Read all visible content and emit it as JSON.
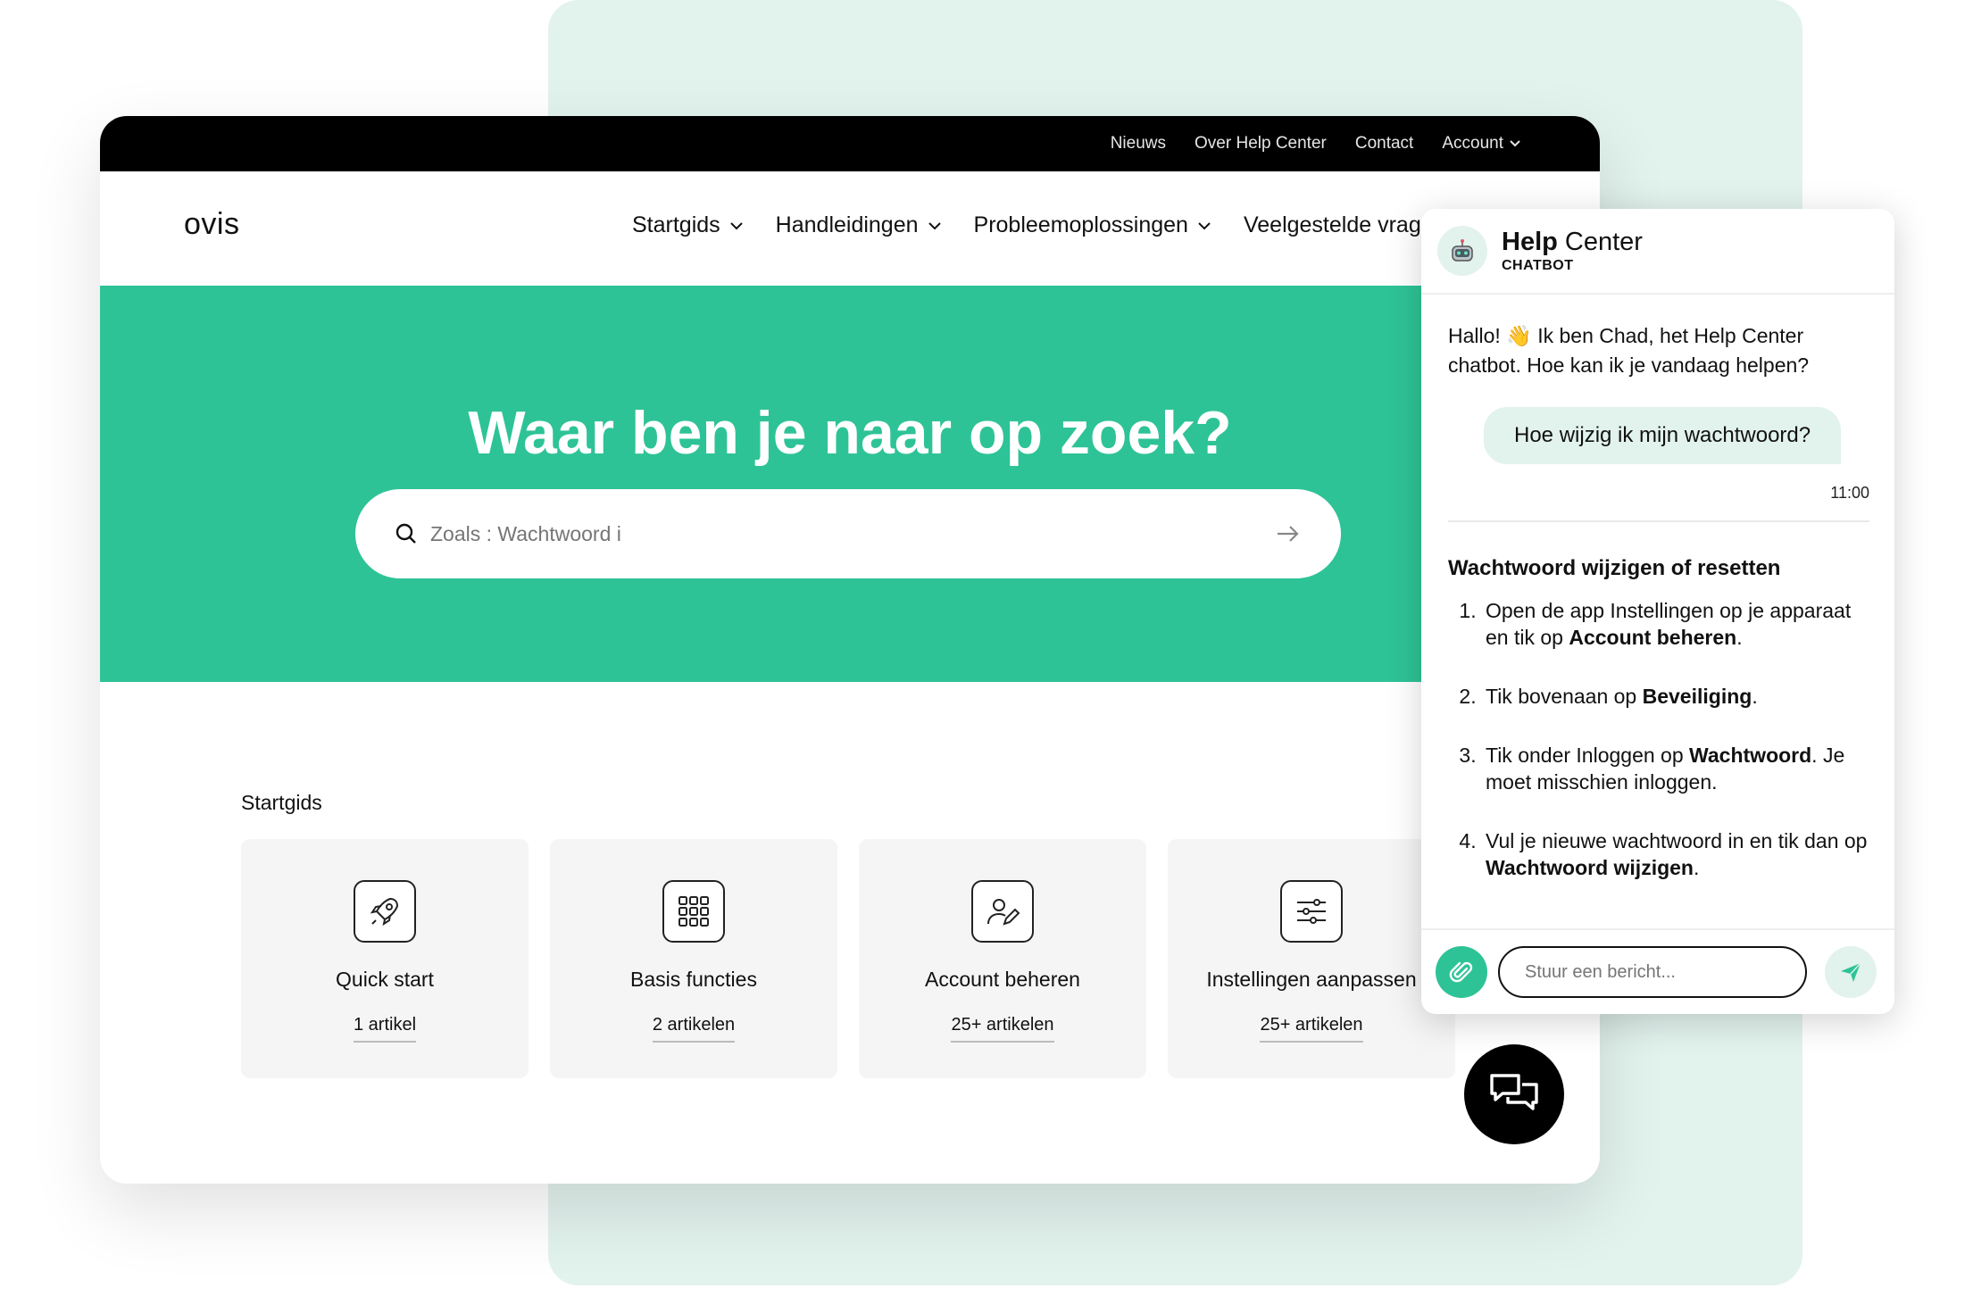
{
  "topbar": {
    "items": [
      "Nieuws",
      "Over Help Center",
      "Contact"
    ],
    "account": "Account"
  },
  "logo": "ovis",
  "menu": [
    "Startgids",
    "Handleidingen",
    "Probleemoplossingen",
    "Veelgestelde vrag"
  ],
  "hero": {
    "title": "Waar ben je naar op zoek?",
    "placeholder": "Zoals : Wachtwoord i"
  },
  "section": {
    "title": "Startgids"
  },
  "cards": [
    {
      "title": "Quick start",
      "count": "1 artikel",
      "icon": "rocket-icon"
    },
    {
      "title": "Basis functies",
      "count": "2 artikelen",
      "icon": "grid-icon"
    },
    {
      "title": "Account beheren",
      "count": "25+ artikelen",
      "icon": "user-edit-icon"
    },
    {
      "title": "Instellingen aanpassen",
      "count": "25+ artikelen",
      "icon": "sliders-icon"
    }
  ],
  "chat": {
    "title_bold": "Help",
    "title_rest": " Center",
    "subtitle": "CHATBOT",
    "greeting_a": "Hallo! ",
    "greeting_emoji": "👋",
    "greeting_b": " Ik ben Chad, het Help Center chatbot. Hoe kan ik je vandaag helpen?",
    "user_message": "Hoe wijzig ik mijn wachtwoord?",
    "time": "11:00",
    "answer_title": "Wachtwoord wijzigen of resetten",
    "steps": [
      {
        "pre": "Open de app Instellingen op je apparaat en tik op ",
        "bold": "Account beheren",
        "post": "."
      },
      {
        "pre": "Tik bovenaan op ",
        "bold": "Beveiliging",
        "post": "."
      },
      {
        "pre": "Tik onder Inloggen op ",
        "bold": "Wachtwoord",
        "post": ". Je moet misschien inloggen."
      },
      {
        "pre": "Vul je nieuwe wachtwoord in en tik dan op ",
        "bold": "Wachtwoord wijzigen",
        "post": "."
      }
    ],
    "input_placeholder": "Stuur een bericht..."
  },
  "colors": {
    "accent": "#2ec396",
    "mint": "#e2f2ed",
    "dark": "#000000"
  }
}
